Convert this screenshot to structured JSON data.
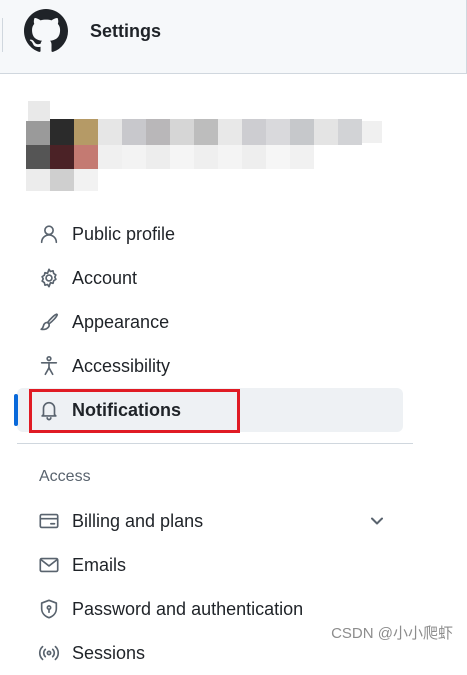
{
  "header": {
    "title": "Settings",
    "logo_icon": "github-octocat-icon"
  },
  "sidebar": {
    "items": [
      {
        "label": "Public profile",
        "icon": "person-icon"
      },
      {
        "label": "Account",
        "icon": "gear-icon"
      },
      {
        "label": "Appearance",
        "icon": "paintbrush-icon"
      },
      {
        "label": "Accessibility",
        "icon": "accessibility-icon"
      },
      {
        "label": "Notifications",
        "icon": "bell-icon",
        "active": true
      }
    ],
    "access_section": {
      "title": "Access",
      "items": [
        {
          "label": "Billing and plans",
          "icon": "credit-card-icon",
          "expandable": true
        },
        {
          "label": "Emails",
          "icon": "mail-icon"
        },
        {
          "label": "Password and authentication",
          "icon": "shield-lock-icon"
        },
        {
          "label": "Sessions",
          "icon": "broadcast-icon"
        }
      ]
    }
  },
  "colors": {
    "accent": "#0969da",
    "highlight": "#e01b24",
    "active_bg": "#eef1f4"
  },
  "watermark": "CSDN @小小爬虾"
}
